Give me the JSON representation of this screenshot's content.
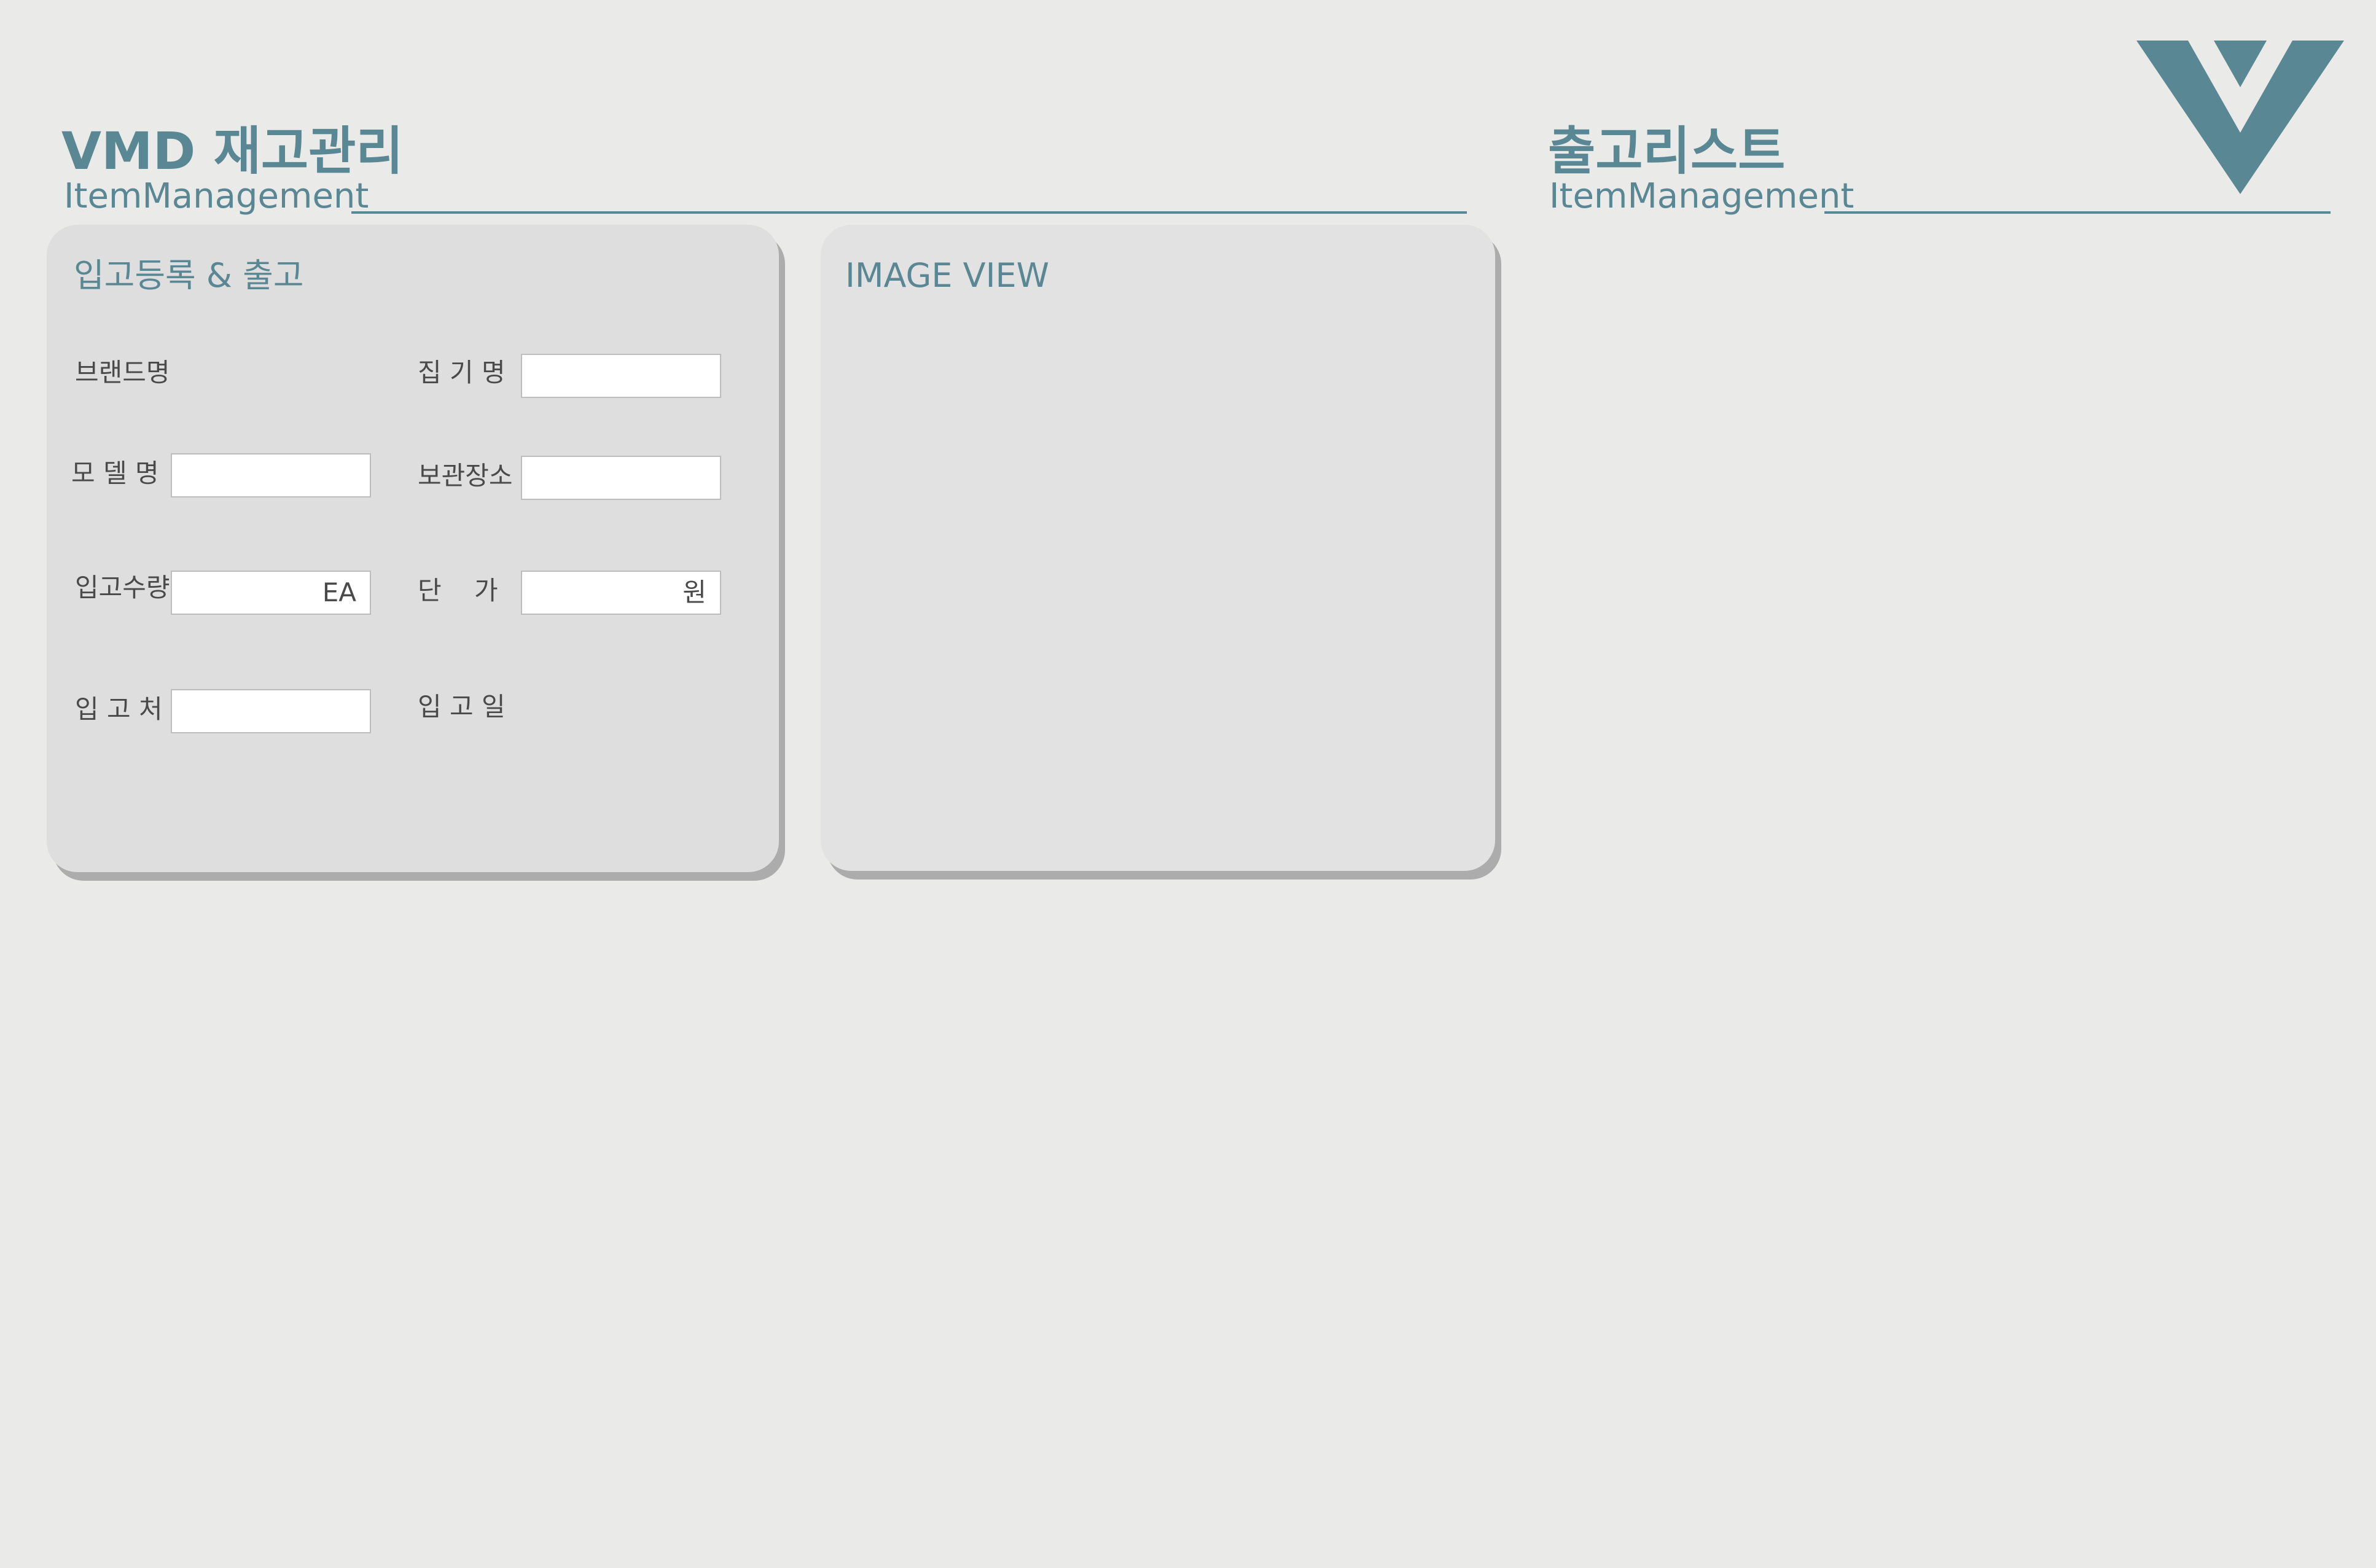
{
  "left_header": {
    "title": "VMD 재고관리",
    "subtitle": "ItemManagement"
  },
  "right_header": {
    "title": "출고리스트",
    "subtitle": "ItemManagement"
  },
  "logo": {
    "icon": "v-logo-icon",
    "color": "#5a8794"
  },
  "form_panel": {
    "title": "입고등록 & 출고",
    "labels": {
      "brand": "브랜드명",
      "model": "모 델 명",
      "quantity": "입고수량",
      "supplier": "입 고 처",
      "fixture": "집 기 명",
      "storage": "보관장소",
      "unit_price": "단    가",
      "date": "입 고 일"
    },
    "units": {
      "quantity": "EA",
      "unit_price": "원"
    }
  },
  "image_panel": {
    "title": "IMAGE VIEW"
  },
  "colors": {
    "accent": "#5a8794",
    "background": "#eaeae8",
    "panel": "#dedede",
    "shadow": "#acacac"
  }
}
